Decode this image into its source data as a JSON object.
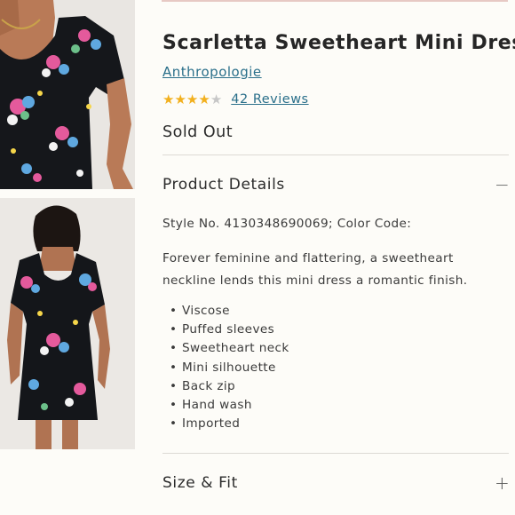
{
  "product": {
    "title": "Scarletta Sweetheart Mini Dress",
    "brand": "Anthropologie",
    "rating_value": 4,
    "rating_max": 5,
    "reviews_label": "42 Reviews",
    "stock_status": "Sold Out"
  },
  "gallery": {
    "images": [
      {
        "alt": "Model wearing floral sweetheart dress, front view"
      },
      {
        "alt": "Model wearing floral sweetheart dress, back view"
      }
    ]
  },
  "product_details": {
    "heading": "Product Details",
    "toggle_icon": "−",
    "style_line": "Style No. 4130348690069; Color Code:",
    "description": "Forever feminine and flattering, a sweetheart neckline lends this mini dress a romantic finish.",
    "features": [
      "Viscose",
      "Puffed sleeves",
      "Sweetheart neck",
      "Mini silhouette",
      "Back zip",
      "Hand wash",
      "Imported"
    ]
  },
  "size_fit": {
    "heading": "Size & Fit",
    "toggle_icon": "+"
  },
  "colors": {
    "link": "#2a6f8a",
    "star_filled": "#f2b01e",
    "star_empty": "#c7c7c7",
    "background": "#fdfcf8",
    "divider": "#dcdad4"
  }
}
